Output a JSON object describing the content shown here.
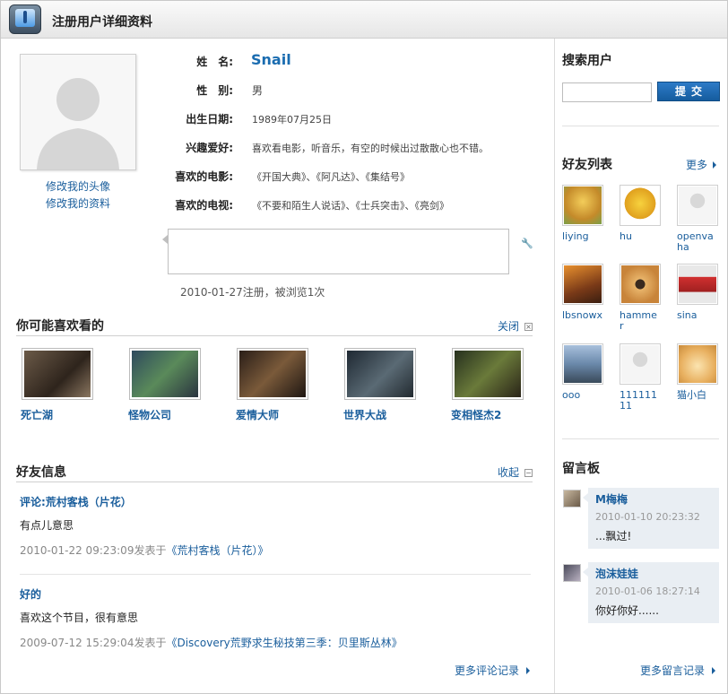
{
  "header": {
    "title": "注册用户详细资料"
  },
  "profile": {
    "edit_avatar": "修改我的头像",
    "edit_profile": "修改我的资料",
    "fields": [
      {
        "label": "姓　名:",
        "value": "Snail"
      },
      {
        "label": "性　别:",
        "value": "男"
      },
      {
        "label": "出生日期:",
        "value": "1989年07月25日"
      },
      {
        "label": "兴趣爱好:",
        "value": "喜欢看电影，听音乐，有空的时候出过散散心也不错。"
      },
      {
        "label": "喜欢的电影:",
        "value": "《开国大典》、《阿凡达》、《集结号》"
      },
      {
        "label": "喜欢的电视:",
        "value": "《不要和陌生人说话》、《士兵突击》、《亮剑》"
      }
    ],
    "reg_info": "2010-01-27注册，被浏览1次"
  },
  "recommend": {
    "title": "你可能喜欢看的",
    "close": "关闭",
    "close_icon": "×",
    "movies": [
      {
        "title": "死亡湖",
        "color": "#5a4a3a"
      },
      {
        "title": "怪物公司",
        "color": "#3d5a6e"
      },
      {
        "title": "爱情大师",
        "color": "#4a3a2e"
      },
      {
        "title": "世界大战",
        "color": "#2e3a44"
      },
      {
        "title": "变相怪杰2",
        "color": "#3e4a2e"
      }
    ]
  },
  "friend_news": {
    "title": "好友信息",
    "collapse": "收起",
    "collapse_icon": "−",
    "items": [
      {
        "title": "评论:荒村客栈（片花）",
        "body": "有点儿意思",
        "date": "2010-01-22 09:23:09发表于",
        "target": "《荒村客栈（片花）》"
      },
      {
        "title": "好的",
        "body": "喜欢这个节目，很有意思",
        "date": "2009-07-12 15:29:04发表于",
        "target": "《Discovery荒野求生秘技第三季：贝里斯丛林》"
      }
    ],
    "more": "更多评论记录"
  },
  "sidebar": {
    "search_title": "搜索用户",
    "search_value": "",
    "submit": "提交",
    "friends_title": "好友列表",
    "friends_more": "更多",
    "friends": [
      {
        "name": "liying",
        "color": "#e8b84a"
      },
      {
        "name": "hu",
        "color": "#f0c43a"
      },
      {
        "name": "openvaha",
        "color": "#e6e6e6"
      },
      {
        "name": "lbsnowx",
        "color": "#b8652e"
      },
      {
        "name": "hammer",
        "color": "#d08a3a"
      },
      {
        "name": "sina",
        "color": "#c43a3a"
      },
      {
        "name": "ooo",
        "color": "#8aa4c4"
      },
      {
        "name": "11111111",
        "color": "#e6e6e6"
      },
      {
        "name": "猫小白",
        "color": "#f2d08a"
      }
    ],
    "guestbook_title": "留言板",
    "guestbook": [
      {
        "name": "M梅梅",
        "date": "2010-01-10 20:23:32",
        "message": "...飘过!"
      },
      {
        "name": "泡沫娃娃",
        "date": "2010-01-06 18:27:14",
        "message": "你好你好......"
      }
    ],
    "guestbook_more": "更多留言记录"
  }
}
